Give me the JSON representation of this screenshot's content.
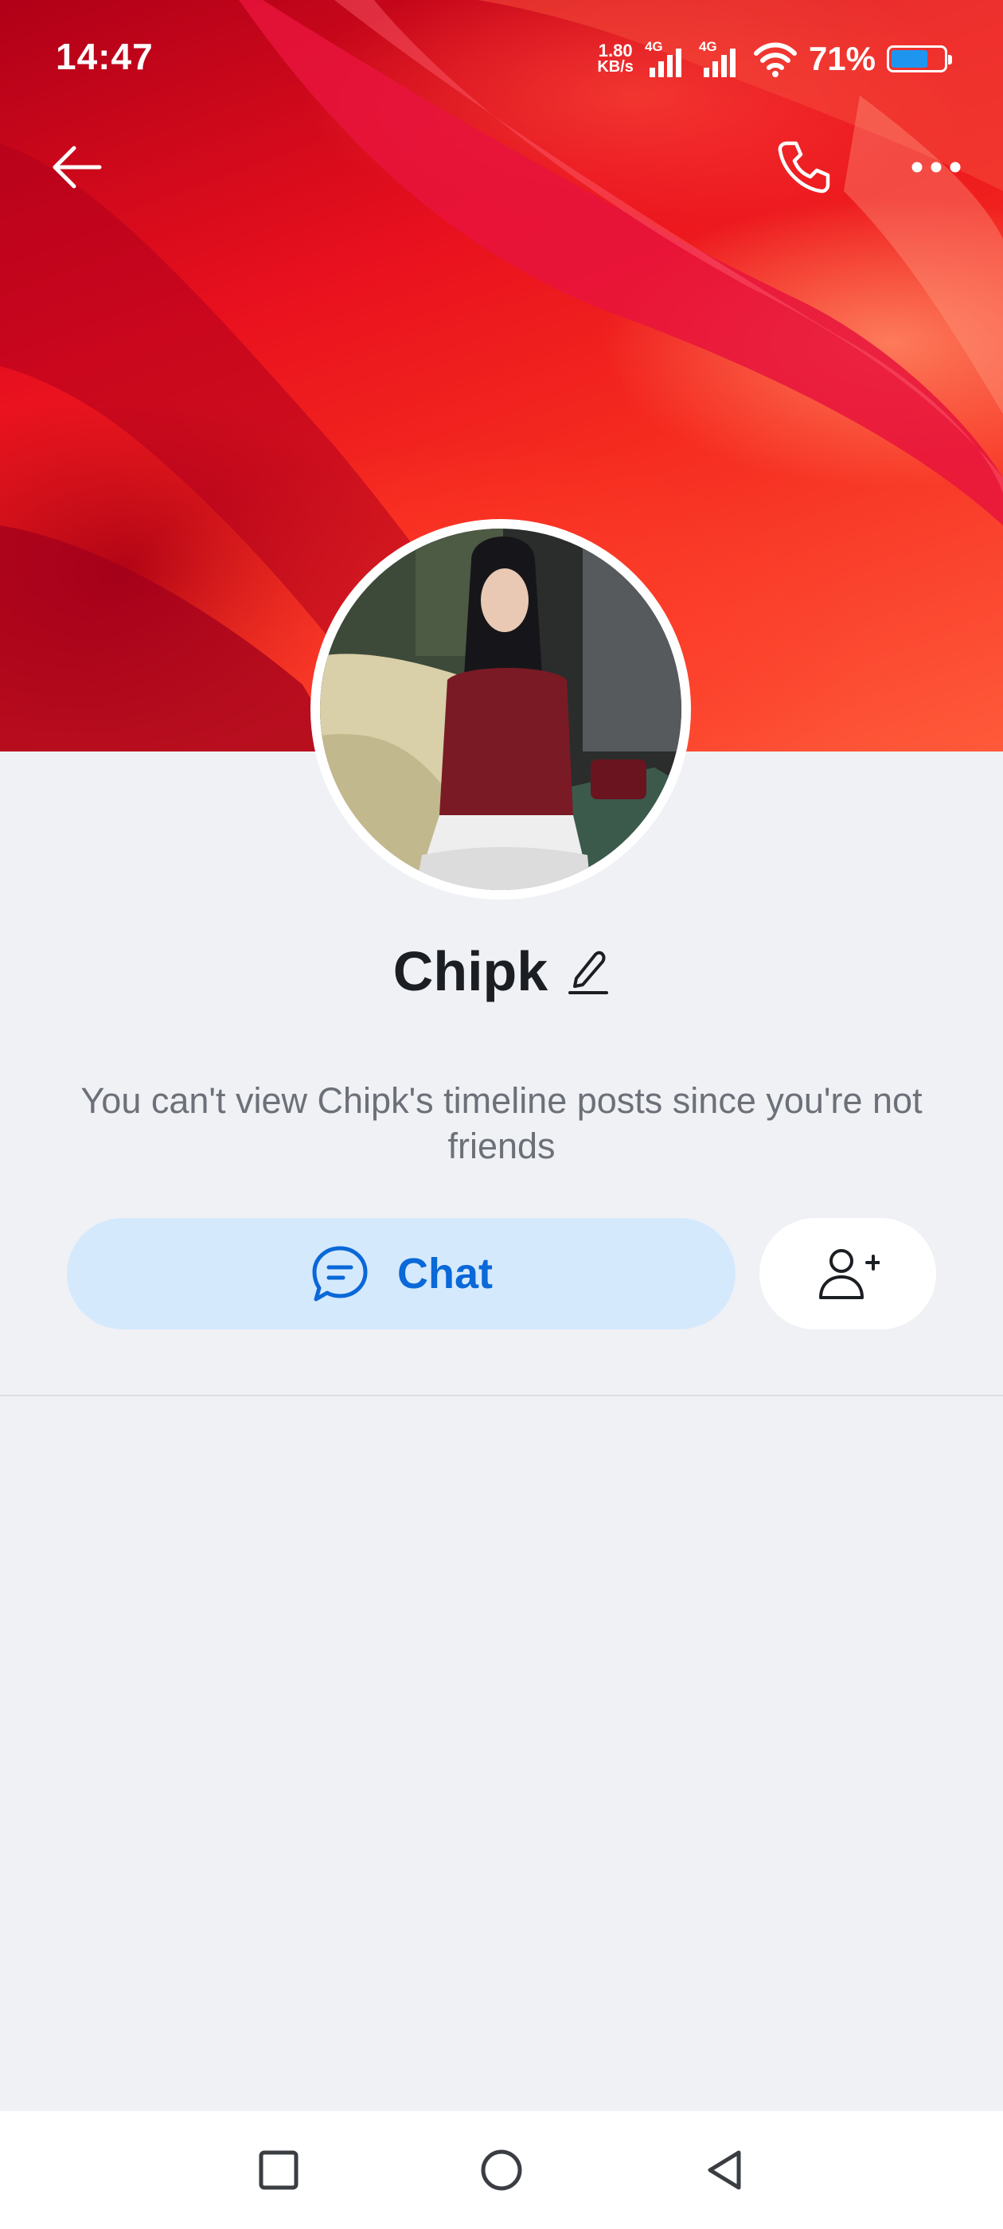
{
  "status_bar": {
    "time": "14:47",
    "net_speed_value": "1.80",
    "net_speed_unit": "KB/s",
    "sim1_type": "4G",
    "sim2_type": "4G",
    "battery_percent": "71%",
    "battery_level": 0.71,
    "battery_color": "#1e96f0"
  },
  "header": {
    "back_icon": "arrow-left-icon",
    "call_icon": "phone-icon",
    "more_icon": "more-horizontal-icon"
  },
  "profile": {
    "name": "Chipk",
    "edit_icon": "pencil-icon",
    "notice": "You can't view Chipk's timeline posts since you're not friends"
  },
  "actions": {
    "chat_label": "Chat",
    "chat_icon": "chat-bubble-icon",
    "add_friend_icon": "add-friend-icon",
    "accent_color": "#0a68d8"
  },
  "system_nav": {
    "recents_icon": "square-icon",
    "home_icon": "circle-icon",
    "back_icon": "triangle-back-icon"
  }
}
